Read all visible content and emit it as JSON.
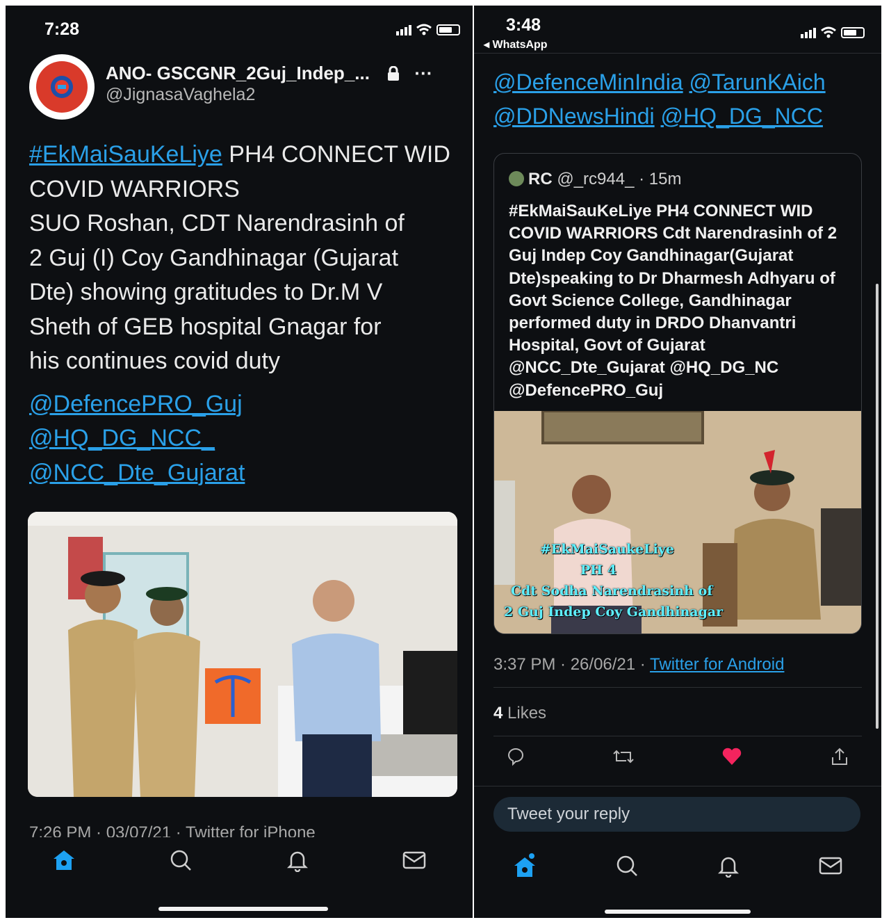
{
  "left": {
    "status_time": "7:28",
    "author_name": "ANO- GSCGNR_2Guj_Indep_...",
    "author_handle": "@JignasaVaghela2",
    "more_label": "···",
    "hashtag": "#EkMaiSauKeLiye",
    "body_after_hashtag": " PH4 CONNECT WID COVID WARRIORS",
    "body_lines": [
      "SUO Roshan, CDT Narendrasinh of",
      "2 Guj (I) Coy Gandhinagar (Gujarat",
      "Dte) showing gratitudes to Dr.M V",
      "Sheth of GEB hospital Gnagar for",
      "his continues covid duty"
    ],
    "mentions": [
      "@DefencePRO_Guj",
      "@HQ_DG_NCC_",
      "@NCC_Dte_Gujarat"
    ],
    "footer_partial": "7:26 PM · 03/07/21 · Twitter for iPhone"
  },
  "right": {
    "status_time": "3:48",
    "back_app": "◂ WhatsApp",
    "top_mentions": [
      "@DefenceMinIndia",
      "@TarunKAich",
      "@DDNewsHindi",
      "@HQ_DG_NCC"
    ],
    "quote": {
      "name": "RC",
      "handle_time": "@_rc944_ · 15m",
      "text": "#EkMaiSauKeLiye PH4 CONNECT WID COVID WARRIORS Cdt Narendrasinh of 2 Guj Indep Coy Gandhinagar(Gujarat Dte)speaking to Dr Dharmesh Adhyaru of Govt Science College, Gandhinagar performed duty in DRDO Dhanvantri Hospital, Govt of Gujarat @NCC_Dte_Gujarat @HQ_DG_NC @DefencePRO_Guj",
      "overlay_lines": [
        "#EkMaiSaukeLiye",
        "PH 4",
        "Cdt Sodha Narendrasinh of",
        "2 Guj Indep Coy Gandhinagar"
      ]
    },
    "timestamp": "3:37 PM · 26/06/21 · ",
    "source": "Twitter for Android",
    "likes_count": "4",
    "likes_label": " Likes",
    "reply_placeholder": "Tweet your reply"
  },
  "colors": {
    "background": "#0d0f12",
    "link": "#2aa0e8",
    "like": "#f4245e",
    "home_active": "#1da1f2"
  },
  "icons": [
    "home-icon",
    "search-icon",
    "notifications-icon",
    "messages-icon",
    "reply-icon",
    "retweet-icon",
    "like-icon",
    "share-icon",
    "lock-icon"
  ]
}
